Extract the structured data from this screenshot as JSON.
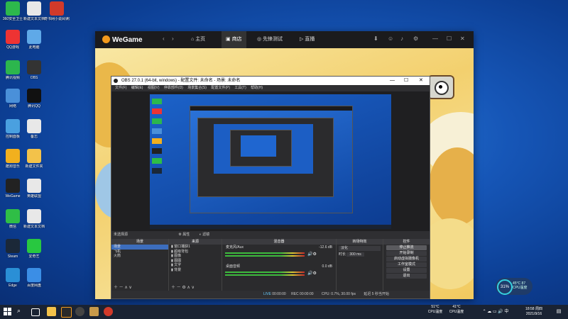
{
  "desktop_icons": [
    {
      "label": "360安全卫士",
      "color": "#2db84c"
    },
    {
      "label": "新建文本文档",
      "color": "#e8e8e8"
    },
    {
      "label": "奇书网小说阅读器",
      "color": "#d23a2a"
    },
    {
      "label": "QQ游戏",
      "color": "#e33"
    },
    {
      "label": "此电脑",
      "color": "#5fa9e8"
    },
    {
      "label": "腾讯视频",
      "color": "#2cb64d"
    },
    {
      "label": "OBS",
      "color": "#333"
    },
    {
      "label": "网络",
      "color": "#4a90d9"
    },
    {
      "label": "腾讯QQ",
      "color": "#111"
    },
    {
      "label": "控制面板",
      "color": "#4aa0e0"
    },
    {
      "label": "备忘",
      "color": "#e8e8e8"
    },
    {
      "label": "酷狗音乐",
      "color": "#f2b01e"
    },
    {
      "label": "新建文件夹",
      "color": "#f3c24a"
    },
    {
      "label": "WeGame",
      "color": "#222"
    },
    {
      "label": "英雄联盟",
      "color": "#e8e8e8"
    },
    {
      "label": "微信",
      "color": "#2fbe46"
    },
    {
      "label": "新建文本文档",
      "color": "#e8e8e8"
    },
    {
      "label": "Steam",
      "color": "#1b2838"
    },
    {
      "label": "爱奇艺",
      "color": "#28c840"
    },
    {
      "label": "Edge",
      "color": "#2a8fd6"
    },
    {
      "label": "百度网盘",
      "color": "#3b8ee6"
    }
  ],
  "wegame": {
    "logo": "WeGame",
    "nav": [
      "主页",
      "商店",
      "先锋测试",
      "直播"
    ],
    "active_nav": "商店",
    "controls": [
      "—",
      "☐",
      "✕"
    ]
  },
  "obs": {
    "title": "OBS 27.0.1 (64-bit, windows) - 配置文件: 未命名 - 场景: 未命名",
    "window_controls": [
      "—",
      "☐",
      "✕"
    ],
    "menu": [
      "文件(F)",
      "编辑(E)",
      "视图(V)",
      "停靠部件(D)",
      "场景集合(S)",
      "配置文件(P)",
      "工具(T)",
      "帮助(H)"
    ],
    "source_bar": {
      "label": "未选择源",
      "properties": "属性",
      "filters": "滤镜"
    },
    "docks": {
      "scenes": {
        "header": "场景",
        "items": [
          "场景",
          "飞机",
          "火箭"
        ],
        "selected": "场景"
      },
      "sources": {
        "header": "来源",
        "items": [
          "窗口捕获1",
          "超级背包",
          "图像",
          "图图",
          "文字",
          "背景"
        ]
      },
      "mixer": {
        "header": "混音器",
        "tracks": [
          {
            "name": "麦克风/Aux",
            "db": "-12.6 dB"
          },
          {
            "name": "桌面音频",
            "db": "0.0 dB"
          }
        ]
      },
      "transitions": {
        "header": "转场特效",
        "type": "淡化",
        "duration_label": "时长",
        "duration": "300 ms"
      },
      "controls": {
        "header": "控件",
        "buttons": [
          "停止推流",
          "开始录制",
          "启动虚拟摄像机",
          "工作室模式",
          "设置",
          "退出"
        ],
        "highlight": "停止推流"
      }
    },
    "status": {
      "live_label": "LIVE",
      "live_time": "00:00:00",
      "rec_label": "REC",
      "rec_time": "00:00:00",
      "cpu": "CPU: 0.7%, 30.00 fps",
      "stream": "延迟 5 秒当开始"
    }
  },
  "cpu_widget": {
    "percent": "31%",
    "temp": "45°C 87",
    "label": "CPU温度"
  },
  "taskbar": {
    "tray_cpu_temp": "51°C",
    "tray_cpu_label": "CPU温度",
    "tray_temp2": "41°C",
    "tray_label2": "CPU温度",
    "time": "18:58 周四",
    "date": "2021/9/16"
  }
}
